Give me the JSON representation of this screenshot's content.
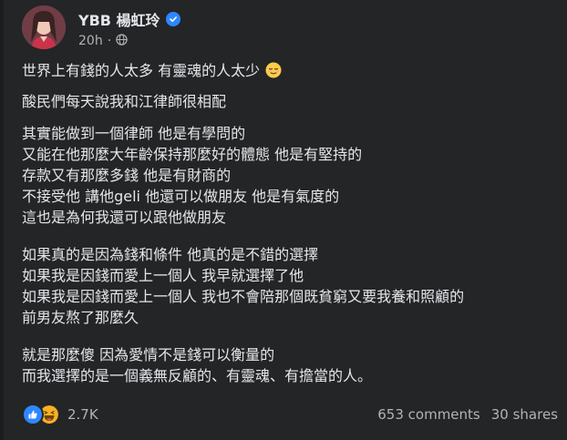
{
  "post": {
    "author": "YBB 楊虹玲",
    "timestamp": "20h",
    "separator": "·",
    "privacy_icon": "globe-icon",
    "verified_icon": "verified-badge-icon"
  },
  "paragraphs": [
    {
      "lines": [
        "世界上有錢的人太多 有靈魂的人太少"
      ],
      "emoji": "relieved-face-icon"
    },
    {
      "lines": [
        "酸民們每天說我和江律師很相配"
      ]
    },
    {
      "lines": [
        "其實能做到一個律師 他是有學問的",
        "又能在他那麼大年齡保持那麼好的體態 他是有堅持的",
        "存款又有那麼多錢 他是有財商的",
        "不接受他  講他geli 他還可以做朋友 他是有氣度的",
        "這也是為何我還可以跟他做朋友"
      ]
    },
    {
      "lines": [
        "如果真的是因為錢和條件 他真的是不錯的選擇",
        "如果我是因錢而愛上一個人  我早就選擇了他",
        "如果我是因錢而愛上一個人 我也不會陪那個既貧窮又要我養和照顧的",
        "前男友熬了那麼久"
      ]
    },
    {
      "lines": [
        "就是那麼傻 因為愛情不是錢可以衡量的",
        "而我選擇的是一個義無反顧的、有靈魂、有擔當的人。"
      ]
    }
  ],
  "footer": {
    "reaction_count": "2.7K",
    "comments": "653 comments",
    "shares": "30 shares",
    "reaction_icons": [
      "like-icon",
      "haha-icon"
    ]
  },
  "colors": {
    "background": "#242526",
    "text": "#e4e6eb",
    "secondary_text": "#b0b3b8",
    "accent": "#2d88ff"
  }
}
